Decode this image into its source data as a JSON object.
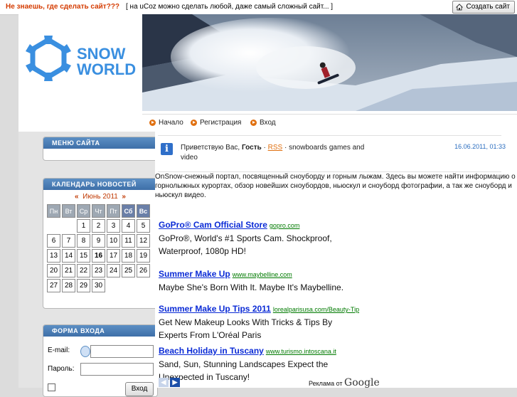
{
  "topbar": {
    "question": "Не знаешь, где сделать сайт???",
    "slogan": "[ на uCoz можно сделать любой, даже самый сложный сайт... ]",
    "create_button": "Создать сайт"
  },
  "logo": {
    "line1": "SNOW",
    "line2": "WORLD",
    "accent_color": "#3a8fe0"
  },
  "nav": [
    {
      "label": "Начало"
    },
    {
      "label": "Регистрация"
    },
    {
      "label": "Вход"
    }
  ],
  "sidebar": {
    "menu_title": "МЕНЮ САЙТА",
    "calendar_title": "КАЛЕНДАРЬ НОВОСТЕЙ",
    "calendar": {
      "prev": "«",
      "month": "Июнь 2011",
      "next": "»",
      "weekdays": [
        "Пн",
        "Вт",
        "Ср",
        "Чт",
        "Пт",
        "Сб",
        "Вс"
      ],
      "weeks": [
        [
          "",
          "",
          "1",
          "2",
          "3",
          "4",
          "5"
        ],
        [
          "6",
          "7",
          "8",
          "9",
          "10",
          "11",
          "12"
        ],
        [
          "13",
          "14",
          "15",
          "16",
          "17",
          "18",
          "19"
        ],
        [
          "20",
          "21",
          "22",
          "23",
          "24",
          "25",
          "26"
        ],
        [
          "27",
          "28",
          "29",
          "30",
          "",
          "",
          ""
        ]
      ],
      "today": "16"
    },
    "login_title": "ФОРМА ВХОДА",
    "login": {
      "email_label": "E-mail:",
      "password_label": "Пароль:",
      "submit": "Вход"
    }
  },
  "welcome": {
    "greeting": "Приветствую Вас,",
    "user": "Гость",
    "separator1": "·",
    "rss": "RSS",
    "separator2": "·",
    "tail": "snowboards games and video",
    "date": "16.06.2011, 01:33"
  },
  "intro": "OnSnow-снежный портал, посвященный сноуборду и горным лыжам. Здесь вы можете найти информацию о горнолыжных курортах, обзор новейших сноубордов, ньюскул и сноуборд фотографии, а так же сноуборд и ньюскул видео.",
  "ads": [
    {
      "title": "GoPro® Cam Official Store",
      "url": "gopro.com",
      "desc": "GoPro®, World's #1 Sports Cam. Shockproof, Waterproof, 1080p HD!"
    },
    {
      "title": "Summer Make Up",
      "url": "www.maybelline.com",
      "desc": "Maybe She's Born With It. Maybe It's Maybelline."
    },
    {
      "title": "Summer Make Up Tips 2011",
      "url": "lorealparisusa.com/Beauty-Tip",
      "desc": "Get New Makeup Looks With Tricks & Tips By Experts From L'Oréal Paris"
    },
    {
      "title": "Beach Holiday in Tuscany",
      "url": "www.turismo.intoscana.it",
      "desc": "Sand, Sun, Stunning Landscapes Expect the Unexpected in Tuscany!"
    }
  ],
  "ads_footer": {
    "prefix": "Реклама от",
    "brand": "Google"
  }
}
